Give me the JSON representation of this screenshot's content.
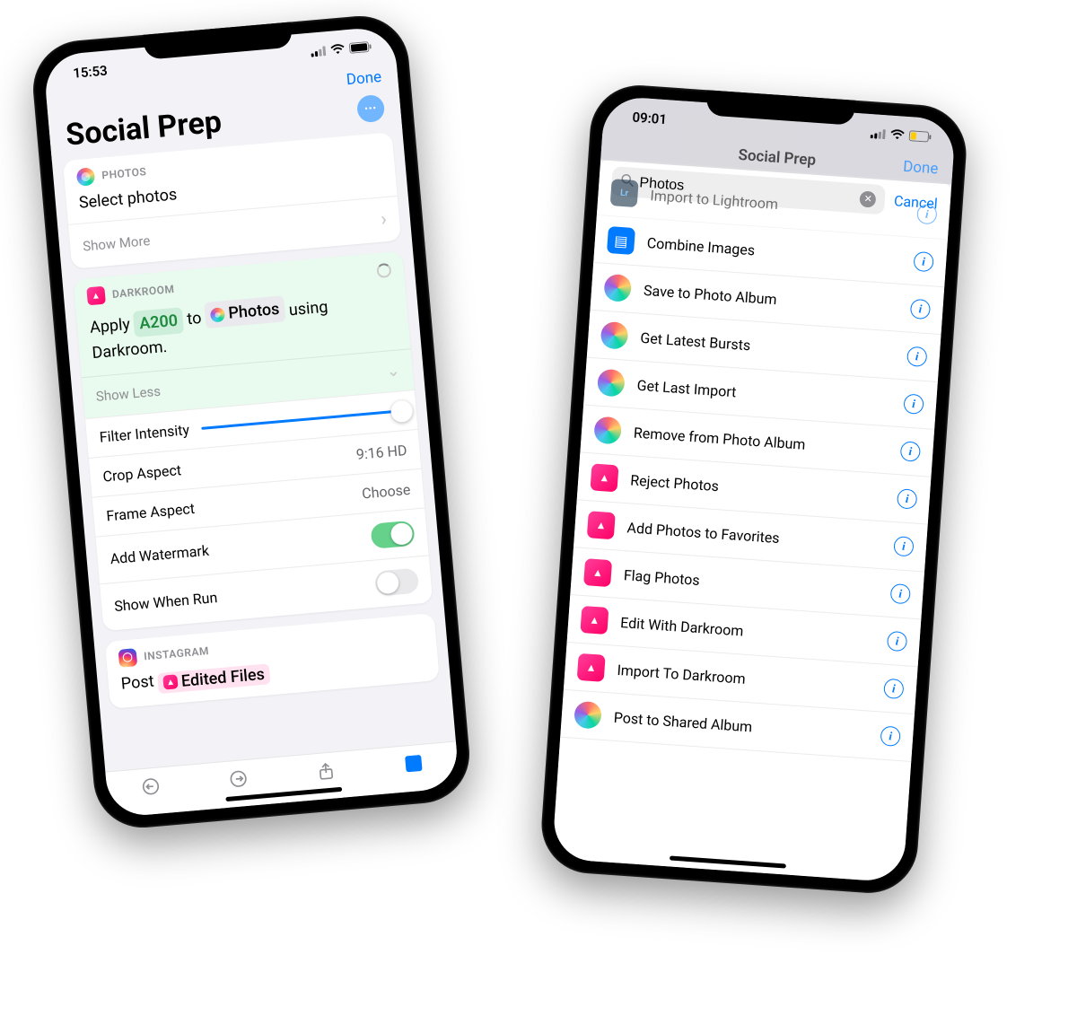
{
  "left": {
    "status": {
      "time": "15:53"
    },
    "header": {
      "done": "Done",
      "title": "Social Prep"
    },
    "photosCard": {
      "appLabel": "PHOTOS",
      "actionTitle": "Select photos",
      "showMore": "Show More"
    },
    "darkroomCard": {
      "appLabel": "DARKROOM",
      "apply": "Apply",
      "filter": "A200",
      "to": "to",
      "photosPill": "Photos",
      "using": "using",
      "darkroomWord": "Darkroom.",
      "showLess": "Show Less",
      "rows": {
        "filterIntensity": "Filter Intensity",
        "cropAspect": "Crop Aspect",
        "cropAspectValue": "9:16 HD",
        "frameAspect": "Frame Aspect",
        "frameAspectValue": "Choose",
        "addWatermark": "Add Watermark",
        "showWhenRun": "Show When Run"
      }
    },
    "instagramCard": {
      "appLabel": "INSTAGRAM",
      "post": "Post",
      "editedFiles": "Edited Files"
    }
  },
  "right": {
    "status": {
      "time": "09:01"
    },
    "peek": {
      "title": "Social Prep",
      "done": "Done"
    },
    "search": {
      "value": "Photos",
      "cancel": "Cancel"
    },
    "actions": [
      {
        "icon": "lightroom-sq",
        "label": "Import to Lightroom"
      },
      {
        "icon": "shortcuts-sq",
        "label": "Combine Images"
      },
      {
        "icon": "photos-round",
        "label": "Save to Photo Album"
      },
      {
        "icon": "photos-round",
        "label": "Get Latest Bursts"
      },
      {
        "icon": "photos-round",
        "label": "Get Last Import"
      },
      {
        "icon": "photos-round",
        "label": "Remove from Photo Album"
      },
      {
        "icon": "darkroom-sq",
        "label": "Reject Photos"
      },
      {
        "icon": "darkroom-sq",
        "label": "Add Photos to Favorites"
      },
      {
        "icon": "darkroom-sq",
        "label": "Flag Photos"
      },
      {
        "icon": "darkroom-sq",
        "label": "Edit With Darkroom"
      },
      {
        "icon": "darkroom-sq",
        "label": "Import To Darkroom"
      },
      {
        "icon": "photos-round",
        "label": "Post to Shared Album"
      }
    ]
  }
}
